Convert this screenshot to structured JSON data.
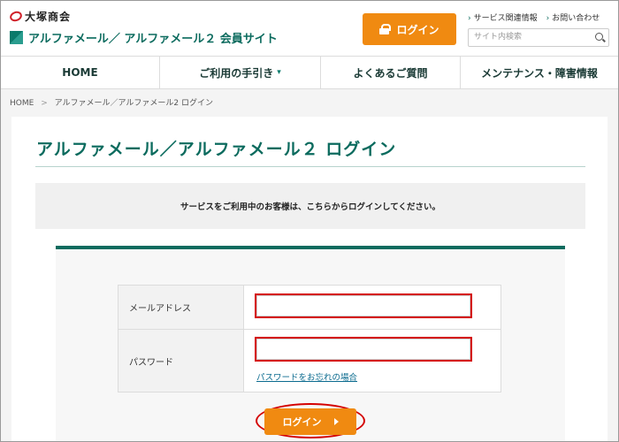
{
  "header": {
    "company_name": "大塚商会",
    "site_title": "アルファメール／ アルファメール２ 会員サイト",
    "login_label": "ログイン",
    "top_links": [
      {
        "label": "サービス関連情報"
      },
      {
        "label": "お問い合わせ"
      }
    ],
    "search": {
      "placeholder": "サイト内検索"
    }
  },
  "nav": {
    "items": [
      {
        "label": "HOME"
      },
      {
        "label": "ご利用の手引き"
      },
      {
        "label": "よくあるご質問"
      },
      {
        "label": "メンテナンス・障害情報"
      }
    ]
  },
  "breadcrumb": {
    "home": "HOME",
    "current": "アルファメール／アルファメール2 ログイン"
  },
  "main": {
    "title": "アルファメール／アルファメール２ ログイン",
    "notice": "サービスをご利用中のお客様は、こちらからログインしてください。",
    "form": {
      "email_label": "メールアドレス",
      "email_value": "",
      "password_label": "パスワード",
      "password_value": "",
      "forgot_link": "パスワードをお忘れの場合",
      "submit_label": "ログイン"
    }
  },
  "colors": {
    "accent": "#f08a11",
    "brand": "#0b6b5e",
    "highlight": "#d40000"
  }
}
